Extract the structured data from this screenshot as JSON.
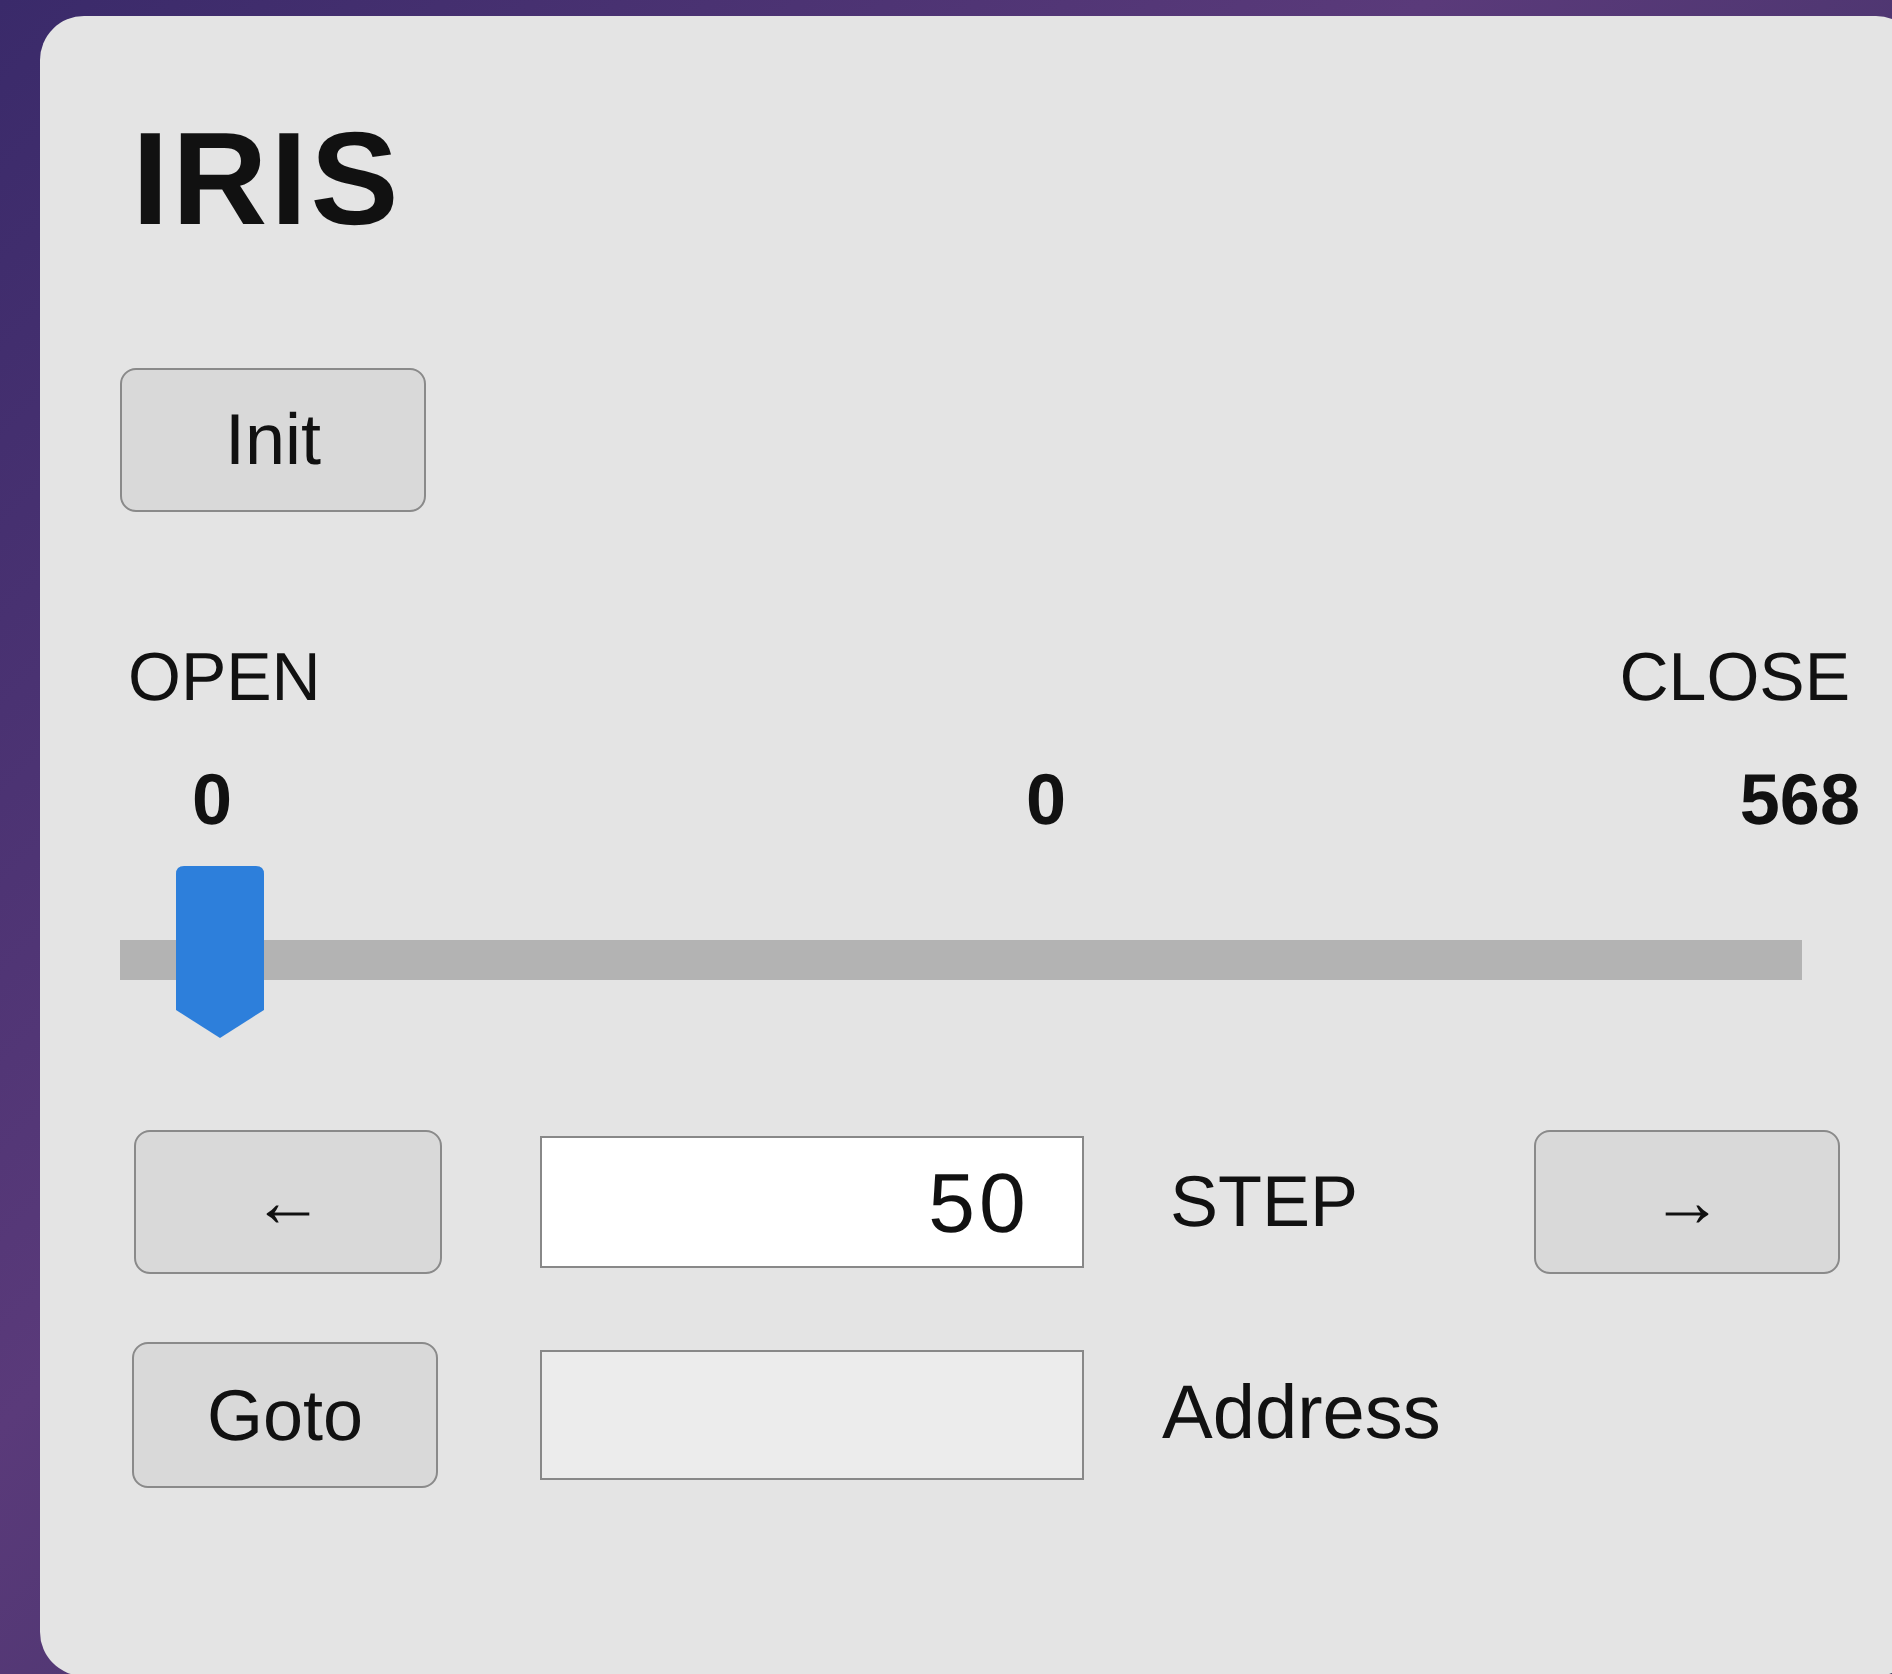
{
  "panel": {
    "title": "IRIS"
  },
  "init_button": "Init",
  "slider": {
    "min_label": "OPEN",
    "max_label": "CLOSE",
    "min_value": "0",
    "current_value": "0",
    "max_value": "568",
    "level": 0
  },
  "step_row": {
    "left_button": "←",
    "step_field": {
      "value": "50"
    },
    "step_label": "STEP",
    "right_button": "→"
  },
  "goto_row": {
    "button": "Goto",
    "address_label": "Address"
  }
}
